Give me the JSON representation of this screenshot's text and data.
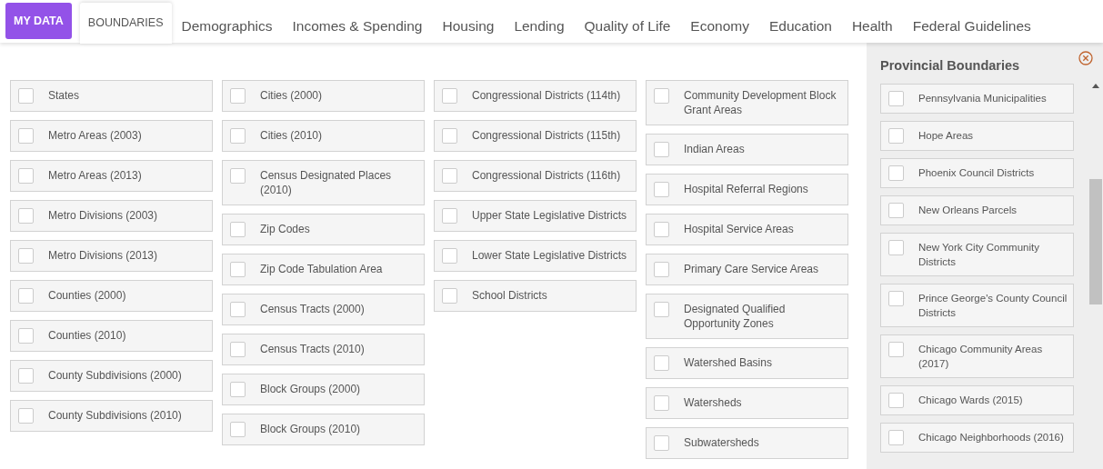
{
  "tabs": [
    {
      "label": "MY DATA",
      "kind": "primary",
      "selected": false
    },
    {
      "label": "BOUNDARIES",
      "kind": "caps",
      "selected": true
    },
    {
      "label": "Demographics",
      "kind": "plain",
      "selected": false
    },
    {
      "label": "Incomes & Spending",
      "kind": "plain",
      "selected": false
    },
    {
      "label": "Housing",
      "kind": "plain",
      "selected": false
    },
    {
      "label": "Lending",
      "kind": "plain",
      "selected": false
    },
    {
      "label": "Quality of Life",
      "kind": "plain",
      "selected": false
    },
    {
      "label": "Economy",
      "kind": "plain",
      "selected": false
    },
    {
      "label": "Education",
      "kind": "plain",
      "selected": false
    },
    {
      "label": "Health",
      "kind": "plain",
      "selected": false
    },
    {
      "label": "Federal Guidelines",
      "kind": "plain",
      "selected": false
    }
  ],
  "columns": [
    [
      {
        "label": "States",
        "checked": false
      },
      {
        "label": "Metro Areas (2003)",
        "checked": false
      },
      {
        "label": "Metro Areas (2013)",
        "checked": false
      },
      {
        "label": "Metro Divisions (2003)",
        "checked": false
      },
      {
        "label": "Metro Divisions (2013)",
        "checked": false
      },
      {
        "label": "Counties (2000)",
        "checked": false
      },
      {
        "label": "Counties (2010)",
        "checked": false
      },
      {
        "label": "County Subdivisions (2000)",
        "checked": false
      },
      {
        "label": "County Subdivisions (2010)",
        "checked": false
      }
    ],
    [
      {
        "label": "Cities (2000)",
        "checked": false
      },
      {
        "label": "Cities (2010)",
        "checked": false
      },
      {
        "label": "Census Designated Places (2010)",
        "checked": false
      },
      {
        "label": "Zip Codes",
        "checked": false
      },
      {
        "label": "Zip Code Tabulation Area",
        "checked": false
      },
      {
        "label": "Census Tracts (2000)",
        "checked": false
      },
      {
        "label": "Census Tracts (2010)",
        "checked": false
      },
      {
        "label": "Block Groups (2000)",
        "checked": false
      },
      {
        "label": "Block Groups (2010)",
        "checked": false
      }
    ],
    [
      {
        "label": "Congressional Districts (114th)",
        "checked": false
      },
      {
        "label": "Congressional Districts (115th)",
        "checked": false
      },
      {
        "label": "Congressional Districts (116th)",
        "checked": false
      },
      {
        "label": "Upper State Legislative Districts",
        "checked": false
      },
      {
        "label": "Lower State Legislative Districts",
        "checked": false
      },
      {
        "label": "School Districts",
        "checked": false
      }
    ],
    [
      {
        "label": "Community Development Block Grant Areas",
        "checked": false
      },
      {
        "label": "Indian Areas",
        "checked": false
      },
      {
        "label": "Hospital Referral Regions",
        "checked": false
      },
      {
        "label": "Hospital Service Areas",
        "checked": false
      },
      {
        "label": "Primary Care Service Areas",
        "checked": false
      },
      {
        "label": "Designated Qualified Opportunity Zones",
        "checked": false
      },
      {
        "label": "Watershed Basins",
        "checked": false
      },
      {
        "label": "Watersheds",
        "checked": false
      },
      {
        "label": "Subwatersheds",
        "checked": false
      }
    ]
  ],
  "side_panel": {
    "title": "Provincial Boundaries",
    "items": [
      {
        "label": "Pennsylvania Municipalities",
        "checked": false
      },
      {
        "label": "Hope Areas",
        "checked": false
      },
      {
        "label": "Phoenix Council Districts",
        "checked": false
      },
      {
        "label": "New Orleans Parcels",
        "checked": false
      },
      {
        "label": "New York City Community Districts",
        "checked": false
      },
      {
        "label": "Prince George's County Council Districts",
        "checked": false
      },
      {
        "label": "Chicago Community Areas (2017)",
        "checked": false
      },
      {
        "label": "Chicago Wards (2015)",
        "checked": false
      },
      {
        "label": "Chicago Neighborhoods (2016)",
        "checked": false
      }
    ]
  }
}
